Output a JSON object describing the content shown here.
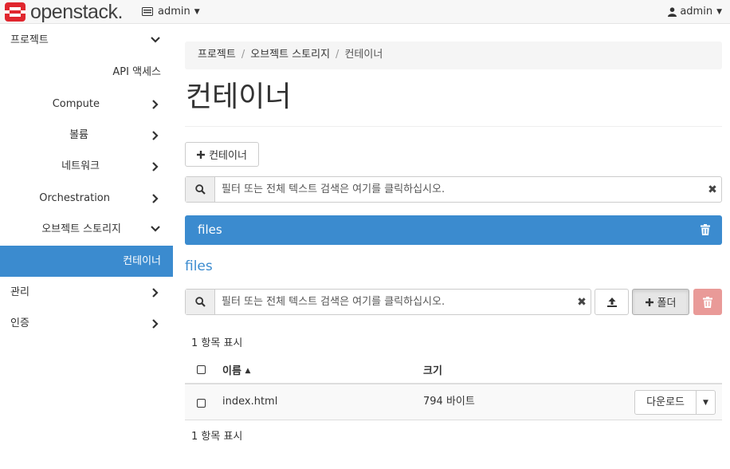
{
  "header": {
    "logo_text": "openstack.",
    "project_dropdown": "admin",
    "user_dropdown": "admin",
    "colors": {
      "brand_red": "#e0262e",
      "accent": "#3b8bcf",
      "danger": "#e99a98"
    }
  },
  "sidebar": {
    "items": [
      {
        "label": "프로젝트",
        "chevron": "down"
      },
      {
        "label": "API 액세스"
      },
      {
        "label": "Compute",
        "chevron": "right"
      },
      {
        "label": "볼륨",
        "chevron": "right"
      },
      {
        "label": "네트워크",
        "chevron": "right"
      },
      {
        "label": "Orchestration",
        "chevron": "right"
      },
      {
        "label": "오브젝트 스토리지",
        "chevron": "down"
      },
      {
        "label": "컨테이너",
        "active": true
      },
      {
        "label": "관리",
        "chevron": "right"
      },
      {
        "label": "인증",
        "chevron": "right"
      }
    ]
  },
  "breadcrumb": {
    "items": [
      "프로젝트",
      "오브젝트 스토리지",
      "컨테이너"
    ],
    "separator": "/"
  },
  "page_title": "컨테이너",
  "create_container_label": "컨테이너",
  "container_filter": {
    "placeholder": "필터 또는 전체 텍스트 검색은 여기를 클릭하십시오."
  },
  "selected_container": {
    "name": "files"
  },
  "objects": {
    "heading": "files",
    "filter_placeholder": "필터 또는 전체 텍스트 검색은 여기를 클릭하십시오.",
    "folder_button": "폴더",
    "count_top": "1 항목 표시",
    "count_bottom": "1 항목 표시",
    "columns": {
      "name": "이름",
      "size": "크기"
    },
    "rows": [
      {
        "name": "index.html",
        "size": "794 바이트",
        "action": "다운로드"
      }
    ]
  }
}
